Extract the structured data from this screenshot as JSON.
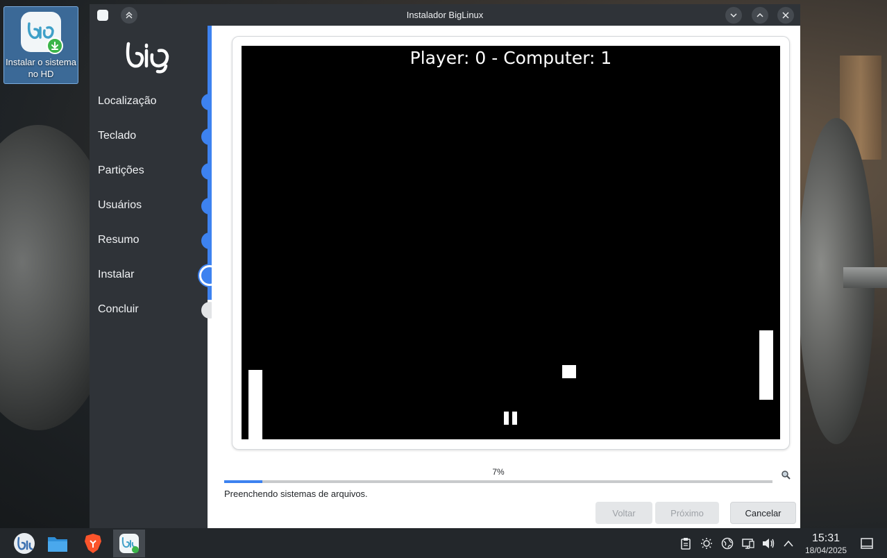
{
  "desktop": {
    "icon_label": "Instalar o sistema no HD"
  },
  "window": {
    "title": "Instalador BigLinux",
    "controls": [
      "chevron-down-icon",
      "chevron-up-icon",
      "close-icon"
    ]
  },
  "sidebar": {
    "steps": [
      {
        "label": "Localização",
        "state": "done"
      },
      {
        "label": "Teclado",
        "state": "done"
      },
      {
        "label": "Partições",
        "state": "done"
      },
      {
        "label": "Usuários",
        "state": "done"
      },
      {
        "label": "Resumo",
        "state": "done"
      },
      {
        "label": "Instalar",
        "state": "current"
      },
      {
        "label": "Concluir",
        "state": "pending"
      }
    ]
  },
  "game": {
    "score_text": "Player: 0 - Computer: 1"
  },
  "progress": {
    "percent_label": "7%",
    "value": 0.07,
    "status_text": "Preenchendo sistemas de arquivos."
  },
  "buttons": {
    "back": "Voltar",
    "next": "Próximo",
    "cancel": "Cancelar"
  },
  "taskbar": {
    "time": "15:31",
    "date": "18/04/2025"
  },
  "colors": {
    "accent": "#3d82f0",
    "sidebar_bg": "#2f3338",
    "taskbar_bg": "#23272b"
  }
}
